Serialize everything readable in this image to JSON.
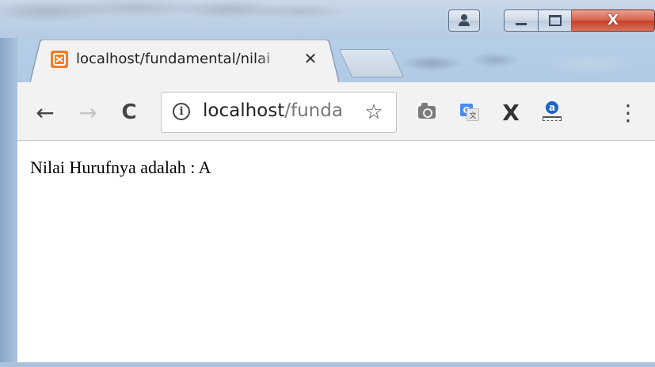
{
  "window": {
    "accent_close": "#c9452f",
    "frame_color": "#a9c4e2"
  },
  "caption_buttons": {
    "user_icon": "user-icon",
    "minimize_icon": "minimize-icon",
    "maximize_icon": "maximize-icon",
    "close_glyph": "X"
  },
  "tab": {
    "title": "localhost/fundamental/nilai",
    "favicon": "xampp-icon",
    "close_glyph": "✕",
    "favicon_color": "#fb7a24"
  },
  "toolbar": {
    "back_glyph": "←",
    "forward_glyph": "→",
    "reload_glyph": "C",
    "info_glyph": "i",
    "url_host": "localhost",
    "url_path": "/funda",
    "star_glyph": "☆",
    "x_extension_glyph": "X",
    "menu_glyph": "⋮",
    "translate_letter": "G",
    "translate_sub": "文",
    "amazon_letter": "a"
  },
  "page": {
    "content": "Nilai Hurufnya adalah : A"
  }
}
